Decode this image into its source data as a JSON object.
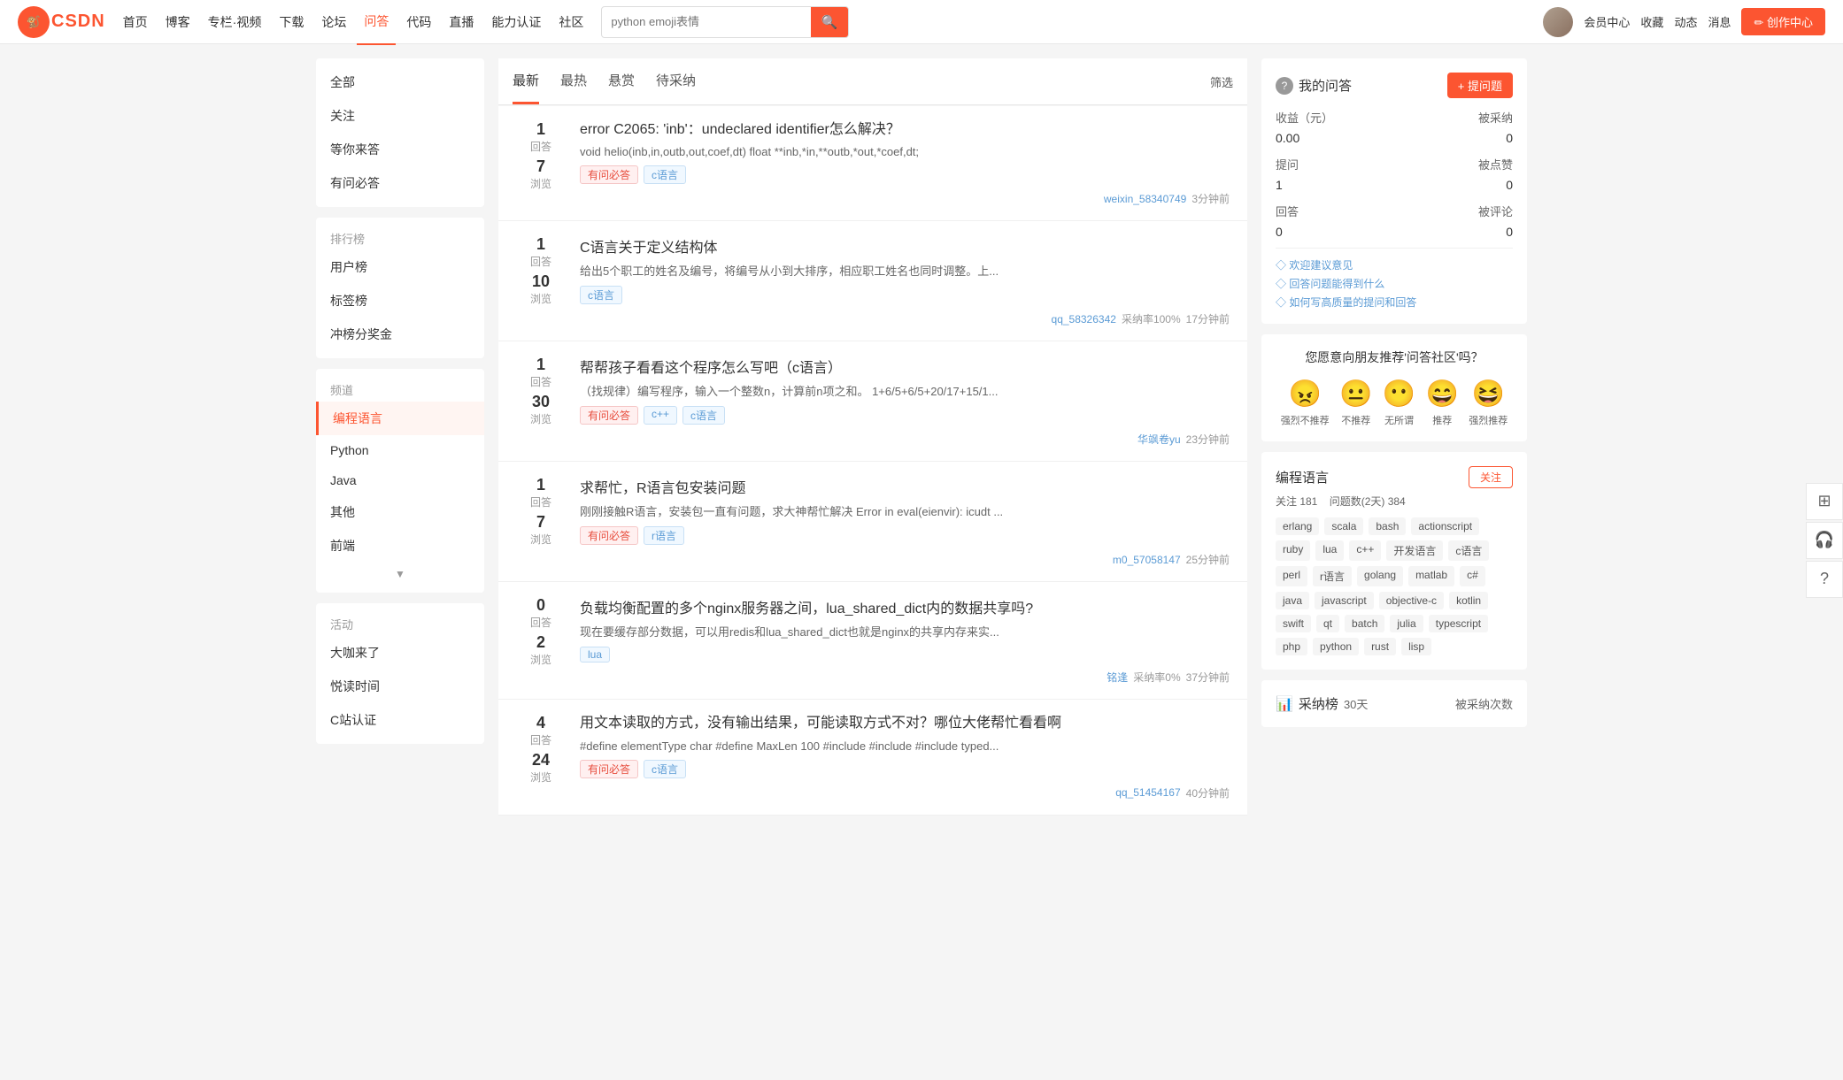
{
  "site": {
    "logo_text": "CSDN",
    "logo_abbr": "C"
  },
  "topnav": {
    "items": [
      {
        "label": "首页",
        "active": false
      },
      {
        "label": "博客",
        "active": false
      },
      {
        "label": "专栏·视频",
        "active": false
      },
      {
        "label": "下载",
        "active": false
      },
      {
        "label": "论坛",
        "active": false
      },
      {
        "label": "问答",
        "active": true
      },
      {
        "label": "代码",
        "active": false
      },
      {
        "label": "直播",
        "active": false
      },
      {
        "label": "能力认证",
        "active": false
      },
      {
        "label": "社区",
        "active": false
      }
    ],
    "search_placeholder": "python emoji表情",
    "search_icon": "🔍",
    "right_items": [
      "会员中心",
      "收藏",
      "动态",
      "消息"
    ],
    "create_btn": "创作中心"
  },
  "sidebar": {
    "top_items": [
      "全部",
      "关注",
      "等你来答",
      "有问必答"
    ],
    "ranking_title": "排行榜",
    "ranking_items": [
      "用户榜",
      "标签榜",
      "冲榜分奖金"
    ],
    "channel_title": "频道",
    "channel_items": [
      "编程语言",
      "Python",
      "Java",
      "其他",
      "前端"
    ],
    "active_channel": "编程语言",
    "activity_title": "活动",
    "activity_items": [
      "大咖来了",
      "悦读时间",
      "C站认证"
    ]
  },
  "content": {
    "tabs": [
      "最新",
      "最热",
      "悬赏",
      "待采纳"
    ],
    "active_tab": "最新",
    "filter_label": "筛选",
    "questions": [
      {
        "id": 1,
        "answers": 1,
        "views": 7,
        "title": "error C2065: 'inb'：undeclared identifier怎么解决？",
        "excerpt": "void helio(inb,in,outb,out,coef,dt)  float **inb,*in,**outb,*out,*coef,dt;",
        "tags": [
          {
            "label": "有问必答",
            "type": "required"
          },
          {
            "label": "c语言",
            "type": "normal"
          }
        ],
        "author": "weixin_58340749",
        "adopt_rate": "",
        "time": "3分钟前"
      },
      {
        "id": 2,
        "answers": 1,
        "views": 10,
        "title": "C语言关于定义结构体",
        "excerpt": "给出5个职工的姓名及编号，将编号从小到大排序，相应职工姓名也同时调整。上...",
        "tags": [
          {
            "label": "c语言",
            "type": "normal"
          }
        ],
        "author": "qq_58326342",
        "adopt_rate": "采纳率100%",
        "time": "17分钟前"
      },
      {
        "id": 3,
        "answers": 1,
        "views": 30,
        "title": "帮帮孩子看看这个程序怎么写吧（c语言）",
        "excerpt": "（找规律）编写程序，输入一个整数n，计算前n项之和。  1+6/5+6/5+20/17+15/1...",
        "tags": [
          {
            "label": "有问必答",
            "type": "required"
          },
          {
            "label": "c++",
            "type": "normal"
          },
          {
            "label": "c语言",
            "type": "normal"
          }
        ],
        "author": "华飒卷yu",
        "adopt_rate": "",
        "time": "23分钟前"
      },
      {
        "id": 4,
        "answers": 1,
        "views": 7,
        "title": "求帮忙，R语言包安装问题",
        "excerpt": "刚刚接触R语言，安装包一直有问题，求大神帮忙解决 Error in eval(eienvir): icudt ...",
        "tags": [
          {
            "label": "有问必答",
            "type": "required"
          },
          {
            "label": "r语言",
            "type": "normal"
          }
        ],
        "author": "m0_57058147",
        "adopt_rate": "",
        "time": "25分钟前"
      },
      {
        "id": 5,
        "answers": 0,
        "views": 2,
        "title": "负载均衡配置的多个nginx服务器之间，lua_shared_dict内的数据共享吗?",
        "excerpt": "现在要缓存部分数据，可以用redis和lua_shared_dict也就是nginx的共享内存来实...",
        "tags": [
          {
            "label": "lua",
            "type": "normal"
          }
        ],
        "author": "铭逢",
        "adopt_rate": "采纳率0%",
        "time": "37分钟前"
      },
      {
        "id": 6,
        "answers": 4,
        "views": 24,
        "title": "用文本读取的方式，没有输出结果，可能读取方式不对？哪位大佬帮忙看看啊",
        "excerpt": "#define elementType char #define MaxLen 100 #include #include #include typed...",
        "tags": [
          {
            "label": "有问必答",
            "type": "required"
          },
          {
            "label": "c语言",
            "type": "normal"
          }
        ],
        "author": "qq_51454167",
        "adopt_rate": "",
        "time": "40分钟前"
      }
    ]
  },
  "right_panel": {
    "my_qa": {
      "title": "我的问答",
      "ask_btn": "+ 提问题",
      "stats": [
        {
          "label": "收益（元）",
          "value": "0.00"
        },
        {
          "label": "被采纳",
          "value": "0"
        },
        {
          "label": "提问",
          "value": "1"
        },
        {
          "label": "被点赞",
          "value": "0"
        },
        {
          "label": "回答",
          "value": "0"
        },
        {
          "label": "被评论",
          "value": "0"
        }
      ],
      "links": [
        "◇ 欢迎建议意见",
        "◇ 回答问题能得到什么",
        "◇ 如何写高质量的提问和回答"
      ]
    },
    "recommend": {
      "title": "您愿意向朋友推荐'问答社区'吗？",
      "emojis": [
        {
          "face": "😠",
          "label": "强烈不推荐"
        },
        {
          "face": "😐",
          "label": "不推荐"
        },
        {
          "face": "😶",
          "label": "无所谓"
        },
        {
          "face": "😄",
          "label": "推荐"
        },
        {
          "face": "😆",
          "label": "强烈推荐"
        }
      ]
    },
    "channel": {
      "title": "编程语言",
      "follow_count": "关注 181",
      "question_count": "问题数(2天) 384",
      "follow_btn": "关注",
      "tags": [
        "erlang",
        "scala",
        "bash",
        "actionscript",
        "ruby",
        "lua",
        "c++",
        "开发语言",
        "c语言",
        "perl",
        "r语言",
        "golang",
        "matlab",
        "c#",
        "java",
        "javascript",
        "objective-c",
        "kotlin",
        "swift",
        "qt",
        "batch",
        "julia",
        "typescript",
        "php",
        "python",
        "rust",
        "lisp"
      ]
    },
    "leaderboard": {
      "title": "采纳榜",
      "period": "30天",
      "label2": "被采纳次数"
    }
  }
}
